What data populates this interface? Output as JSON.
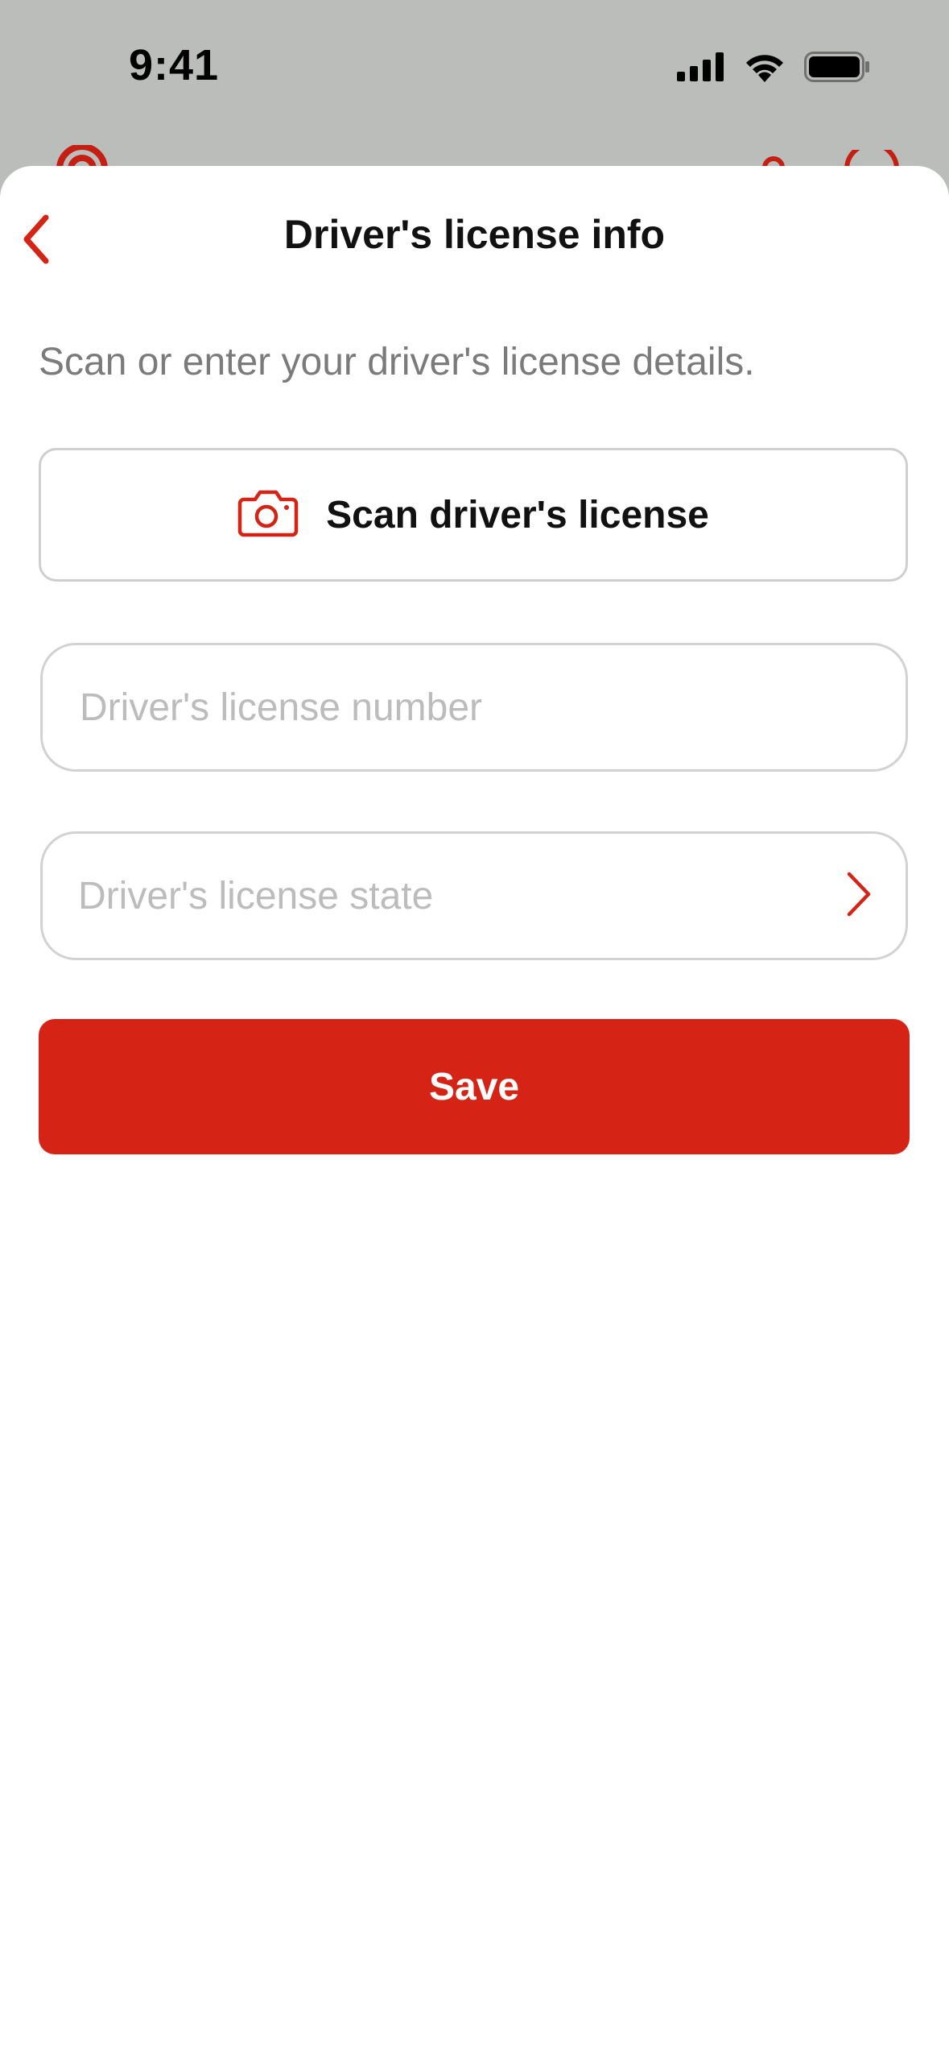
{
  "status_bar": {
    "time": "9:41",
    "icons": [
      "cellular-signal-icon",
      "wifi-icon",
      "battery-icon"
    ]
  },
  "header": {
    "title": "Driver's license info",
    "back_icon": "chevron-left-icon"
  },
  "main": {
    "subtitle": "Scan or enter your driver's license details.",
    "scan_button": {
      "label": "Scan driver's license",
      "icon": "camera-icon"
    },
    "license_number_field": {
      "value": "",
      "placeholder": "Driver's license number"
    },
    "license_state_field": {
      "value": "",
      "placeholder": "Driver's license state",
      "icon": "chevron-right-icon"
    },
    "save_label": "Save"
  },
  "colors": {
    "accent": "#d52415",
    "background_dim": "#bbbdba",
    "placeholder": "#bcbcbc",
    "subtitle": "#7b7b7b"
  }
}
